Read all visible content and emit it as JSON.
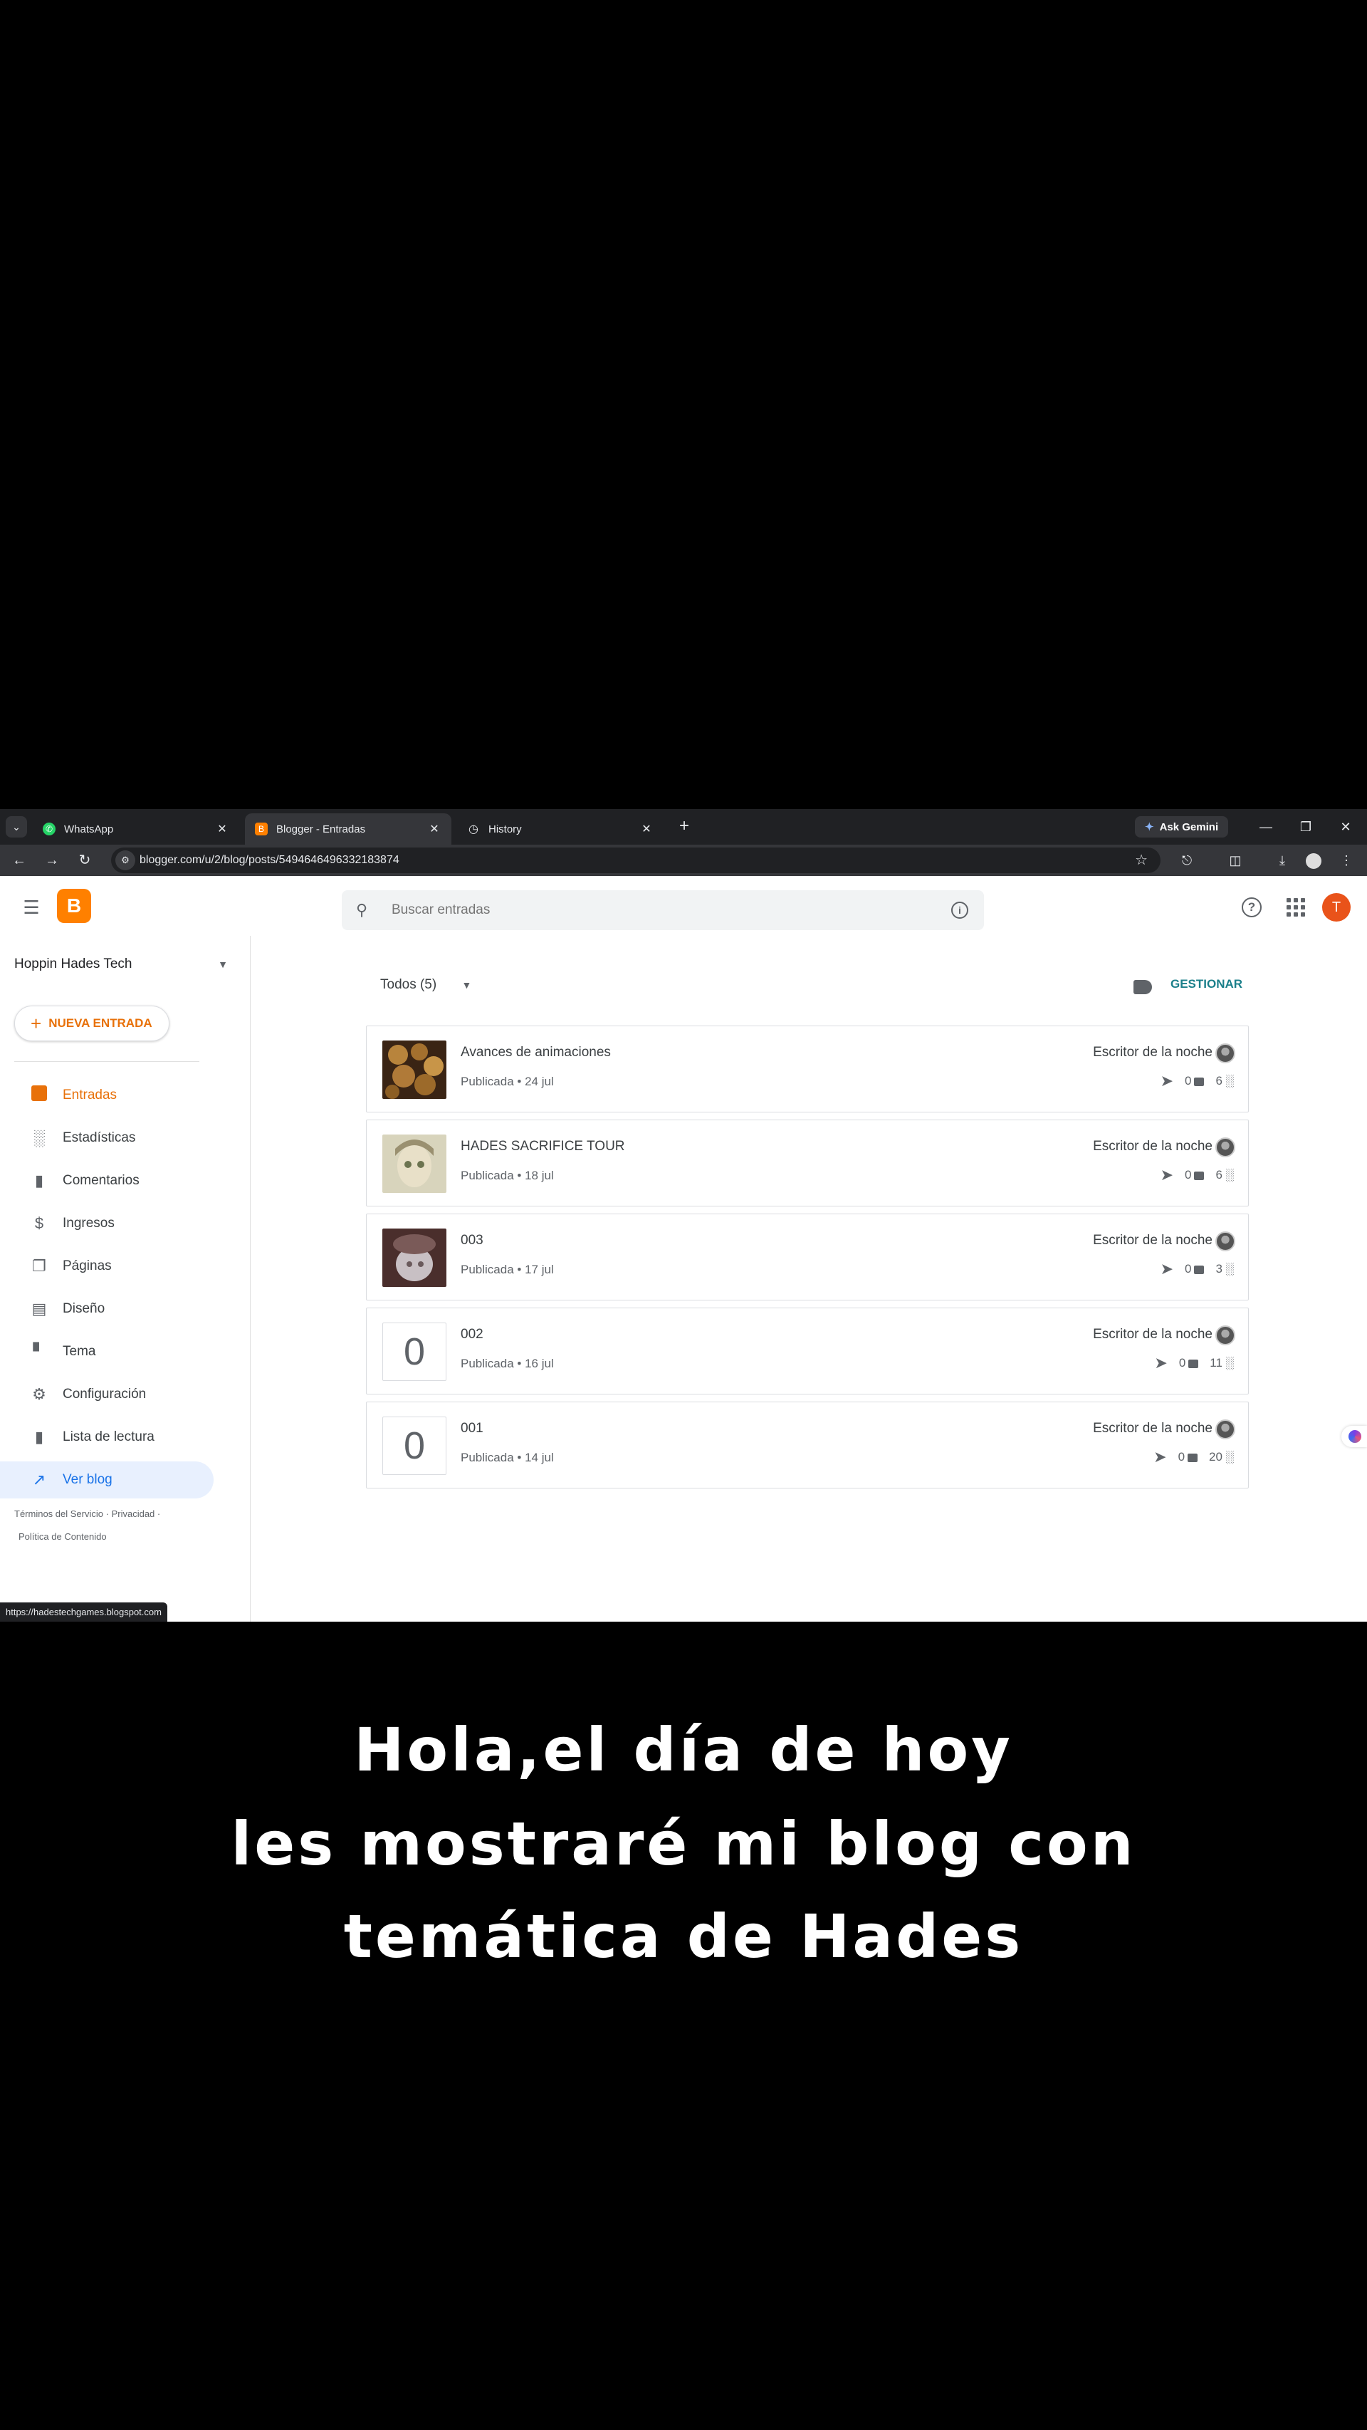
{
  "browser": {
    "tabs": [
      {
        "title": "WhatsApp",
        "favicon_color": "#25d366"
      },
      {
        "title": "Blogger - Entradas",
        "favicon_color": "#ff8000"
      },
      {
        "title": "History",
        "favicon_color": "#5f6368"
      }
    ],
    "active_tab": 1,
    "gemini_label": "Ask Gemini",
    "url": "blogger.com/u/2/blog/posts/5494646496332183874",
    "status_url": "https://hadestechgames.blogspot.com"
  },
  "header": {
    "search_placeholder": "Buscar entradas",
    "avatar_letter": "T"
  },
  "sidebar": {
    "blog_name": "Hoppin Hades Tech",
    "new_post_label": "NUEVA ENTRADA",
    "items": [
      {
        "label": "Entradas",
        "icon": "posts-icon"
      },
      {
        "label": "Estadísticas",
        "icon": "stats-icon"
      },
      {
        "label": "Comentarios",
        "icon": "comment-icon"
      },
      {
        "label": "Ingresos",
        "icon": "dollar-icon"
      },
      {
        "label": "Páginas",
        "icon": "pages-icon"
      },
      {
        "label": "Diseño",
        "icon": "layout-icon"
      },
      {
        "label": "Tema",
        "icon": "paint-roller-icon"
      },
      {
        "label": "Configuración",
        "icon": "gear-icon"
      },
      {
        "label": "Lista de lectura",
        "icon": "bookmark-icon"
      },
      {
        "label": "Ver blog",
        "icon": "open-external-icon"
      }
    ],
    "footer": {
      "terms": "Términos del Servicio",
      "privacy": "Privacidad",
      "content_policy": "Política de Contenido"
    }
  },
  "main": {
    "filter_label": "Todos (5)",
    "manage_label": "GESTIONAR",
    "posts": [
      {
        "title": "Avances de animaciones",
        "status": "Publicada • 24 jul",
        "author": "Escritor de la noche",
        "comments": "0",
        "views": "6",
        "thumb": "image"
      },
      {
        "title": "HADES SACRIFICE TOUR",
        "status": "Publicada • 18 jul",
        "author": "Escritor de la noche",
        "comments": "0",
        "views": "6",
        "thumb": "image"
      },
      {
        "title": "003",
        "status": "Publicada • 17 jul",
        "author": "Escritor de la noche",
        "comments": "0",
        "views": "3",
        "thumb": "image"
      },
      {
        "title": "002",
        "status": "Publicada • 16 jul",
        "author": "Escritor de la noche",
        "comments": "0",
        "views": "11",
        "thumb": "0"
      },
      {
        "title": "001",
        "status": "Publicada • 14 jul",
        "author": "Escritor de la noche",
        "comments": "0",
        "views": "20",
        "thumb": "0"
      }
    ]
  },
  "caption": {
    "line1": "Hola,el día de hoy",
    "line2": "les mostraré mi blog con",
    "line3": "temática de Hades"
  }
}
